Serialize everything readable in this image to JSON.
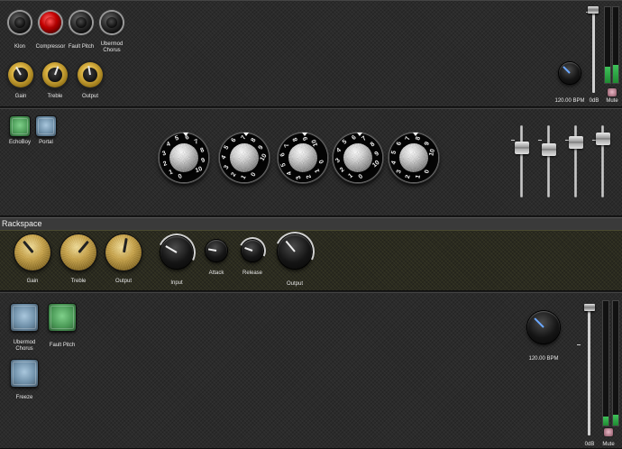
{
  "top_panel": {
    "switches": [
      {
        "label": "Klon",
        "state": "off"
      },
      {
        "label": "Compressor",
        "state": "on"
      },
      {
        "label": "Fault Pitch",
        "state": "off"
      },
      {
        "label": "Ubermod Chorus",
        "state": "off"
      }
    ],
    "knobs": [
      {
        "label": "Gain"
      },
      {
        "label": "Treble"
      },
      {
        "label": "Output"
      }
    ],
    "tempo": "120.00 BPM",
    "volume_label": "0dB",
    "mute_label": "Mute"
  },
  "second_panel": {
    "buttons": [
      {
        "label": "EchoBoy",
        "color": "#4b9a57"
      },
      {
        "label": "Portal",
        "color": "#6e8fa8"
      }
    ],
    "numbered_knobs_count": 5,
    "scale_numbers": [
      "0",
      "1",
      "2",
      "3",
      "4",
      "5",
      "6",
      "7",
      "8",
      "9",
      "10"
    ]
  },
  "rackspace": {
    "title": "Rackspace",
    "knobs": [
      {
        "label": "Gain"
      },
      {
        "label": "Treble"
      },
      {
        "label": "Output"
      },
      {
        "label": "Input"
      },
      {
        "label": "Attack"
      },
      {
        "label": "Release"
      },
      {
        "label": "Output"
      }
    ]
  },
  "bottom_panel": {
    "buttons": [
      {
        "label": "Ubermod Chorus",
        "color": "#6e8fa8"
      },
      {
        "label": "Fault Pitch",
        "color": "#4b9a57"
      },
      {
        "label": "Freeze",
        "color": "#6e8fa8"
      }
    ],
    "tempo": "120.00 BPM",
    "volume_label": "0dB",
    "mute_label": "Mute"
  },
  "colors": {
    "switch_on": "#c40000",
    "meter_green": "#3fc25a",
    "gold": "#d9b040",
    "rackspace_bg": "#2a2a20"
  }
}
